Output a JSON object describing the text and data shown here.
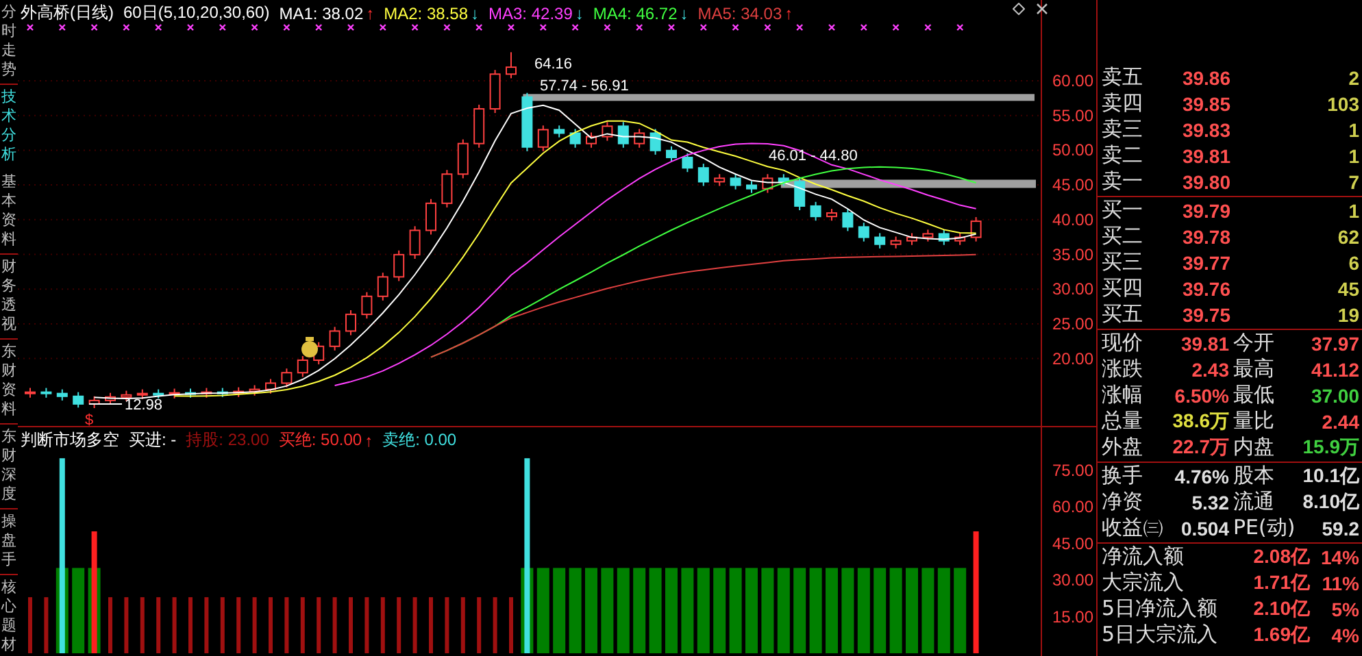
{
  "side_tabs": [
    {
      "label": "分时走势",
      "selected": false
    },
    {
      "label": "技术分析",
      "selected": true
    },
    {
      "label": "基本资料",
      "selected": false
    },
    {
      "label": "财务透视",
      "selected": false
    },
    {
      "label": "东财资料",
      "selected": false
    },
    {
      "label": "东财深度",
      "selected": false
    },
    {
      "label": "操盘手",
      "selected": false
    },
    {
      "label": "核心题材",
      "selected": false
    }
  ],
  "price_chart": {
    "header": {
      "title": "外高桥(日线)",
      "period": "60日(5,10,20,30,60)",
      "averages": [
        {
          "label": "MA1: 38.02",
          "color": "#ffffff",
          "arrow": "↑"
        },
        {
          "label": "MA2: 38.58",
          "color": "#ffff40",
          "arrow": "↓"
        },
        {
          "label": "MA3: 42.39",
          "color": "#ff40ff",
          "arrow": "↓"
        },
        {
          "label": "MA4: 46.72",
          "color": "#40ff40",
          "arrow": "↓"
        },
        {
          "label": "MA5: 34.03",
          "color": "#e04040",
          "arrow": "↑"
        }
      ]
    },
    "axis_labels": [
      "60.00",
      "55.00",
      "50.00",
      "45.00",
      "40.00",
      "35.00",
      "30.00",
      "25.00",
      "20.00"
    ],
    "annotations": [
      "64.16",
      "57.74 - 56.91",
      "46.01 - 44.80",
      "12.98"
    ],
    "marker": "$"
  },
  "indicator": {
    "header": {
      "title": "判断市场多空",
      "items": [
        {
          "label": "买进: -",
          "color": "#ffffff"
        },
        {
          "label": "持股: 23.00",
          "color": "#a01010"
        },
        {
          "label": "买绝: 50.00",
          "color": "#ff3030",
          "arrow": "↑"
        },
        {
          "label": "卖绝: 0.00",
          "color": "#40e0e0"
        }
      ]
    },
    "axis_labels": [
      "75.00",
      "60.00",
      "45.00",
      "30.00",
      "15.00"
    ]
  },
  "order_book": {
    "sell": [
      {
        "label": "卖五",
        "price": "39.86",
        "volume": "2"
      },
      {
        "label": "卖四",
        "price": "39.85",
        "volume": "103"
      },
      {
        "label": "卖三",
        "price": "39.83",
        "volume": "1"
      },
      {
        "label": "卖二",
        "price": "39.81",
        "volume": "1"
      },
      {
        "label": "卖一",
        "price": "39.80",
        "volume": "7"
      }
    ],
    "buy": [
      {
        "label": "买一",
        "price": "39.79",
        "volume": "1"
      },
      {
        "label": "买二",
        "price": "39.78",
        "volume": "62"
      },
      {
        "label": "买三",
        "price": "39.77",
        "volume": "6"
      },
      {
        "label": "买四",
        "price": "39.76",
        "volume": "45"
      },
      {
        "label": "买五",
        "price": "39.75",
        "volume": "19"
      }
    ]
  },
  "quote": [
    {
      "label": "现价",
      "value": "39.81",
      "color": "#ff5050"
    },
    {
      "label": "今开",
      "value": "37.97",
      "color": "#ff5050"
    },
    {
      "label": "涨跌",
      "value": "2.43",
      "color": "#ff5050"
    },
    {
      "label": "最高",
      "value": "41.12",
      "color": "#ff5050"
    },
    {
      "label": "涨幅",
      "value": "6.50%",
      "color": "#ff5050"
    },
    {
      "label": "最低",
      "value": "37.00",
      "color": "#40d040"
    },
    {
      "label": "总量",
      "value": "38.6万",
      "color": "#e0e040"
    },
    {
      "label": "量比",
      "value": "2.44",
      "color": "#ff5050"
    },
    {
      "label": "外盘",
      "value": "22.7万",
      "color": "#ff5050"
    },
    {
      "label": "内盘",
      "value": "15.9万",
      "color": "#40d040"
    }
  ],
  "fundamentals": [
    {
      "label": "换手",
      "value": "4.76%"
    },
    {
      "label": "股本",
      "value": "10.1亿"
    },
    {
      "label": "净资",
      "value": "5.32"
    },
    {
      "label": "流通",
      "value": "8.10亿"
    },
    {
      "label": "收益㈢",
      "value": "0.504"
    },
    {
      "label": "PE(动)",
      "value": "59.2"
    }
  ],
  "flows": [
    {
      "label": "净流入额",
      "value": "2.08亿",
      "percent": "14%"
    },
    {
      "label": "大宗流入",
      "value": "1.71亿",
      "percent": "11%"
    },
    {
      "label": "5日净流入额",
      "value": "2.10亿",
      "percent": "5%"
    },
    {
      "label": "5日大宗流入",
      "value": "1.69亿",
      "percent": "4%"
    }
  ]
}
